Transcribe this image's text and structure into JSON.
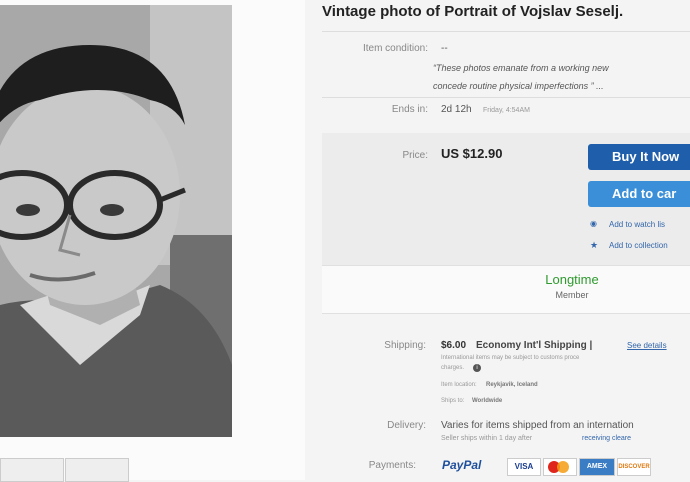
{
  "listing": {
    "title": "Vintage photo of Portrait of Vojslav Seselj.",
    "item_condition_label": "Item condition:",
    "item_condition_value": "--",
    "condition_quote_line1": "“These photos emanate from a working new",
    "condition_quote_line2": "concede routine physical imperfections ” ...",
    "ends_label": "Ends in:",
    "ends_value": "2d 12h",
    "ends_time": "Friday, 4:54AM"
  },
  "purchase": {
    "price_label": "Price:",
    "price_value": "US $12.90",
    "buy_now": "Buy It Now",
    "add_to_cart": "Add to car",
    "watch_list": "Add to watch lis",
    "collection": "Add to collection"
  },
  "seller": {
    "badge": "Longtime",
    "badge_sub": "Member"
  },
  "shipping": {
    "label": "Shipping:",
    "cost": "$6.00",
    "method": "Economy Int'l Shipping |",
    "details_link": "See details",
    "note_line1": "International items may be subject to customs proce",
    "note_line2": "charges.",
    "location_label": "Item location:",
    "location_value": "Reykjavik, Iceland",
    "ships_to_label": "Ships to:",
    "ships_to_value": "Worldwide"
  },
  "delivery": {
    "label": "Delivery:",
    "value": "Varies for items shipped from an internation",
    "note": "Seller ships within 1 day after",
    "note_link": "receiving cleare"
  },
  "payments": {
    "label": "Payments:",
    "paypal": "PayPal",
    "cards": [
      "VISA",
      "MC",
      "AMEX",
      "DISCOVER"
    ]
  },
  "icons": {
    "watch": "eye-icon",
    "collection": "star-icon",
    "info": "info-icon"
  },
  "colors": {
    "buy_now": "#1f5eaa",
    "add_to_cart": "#3a8fd8",
    "longtime_green": "#2e9a2e",
    "link_blue": "#3366aa"
  }
}
